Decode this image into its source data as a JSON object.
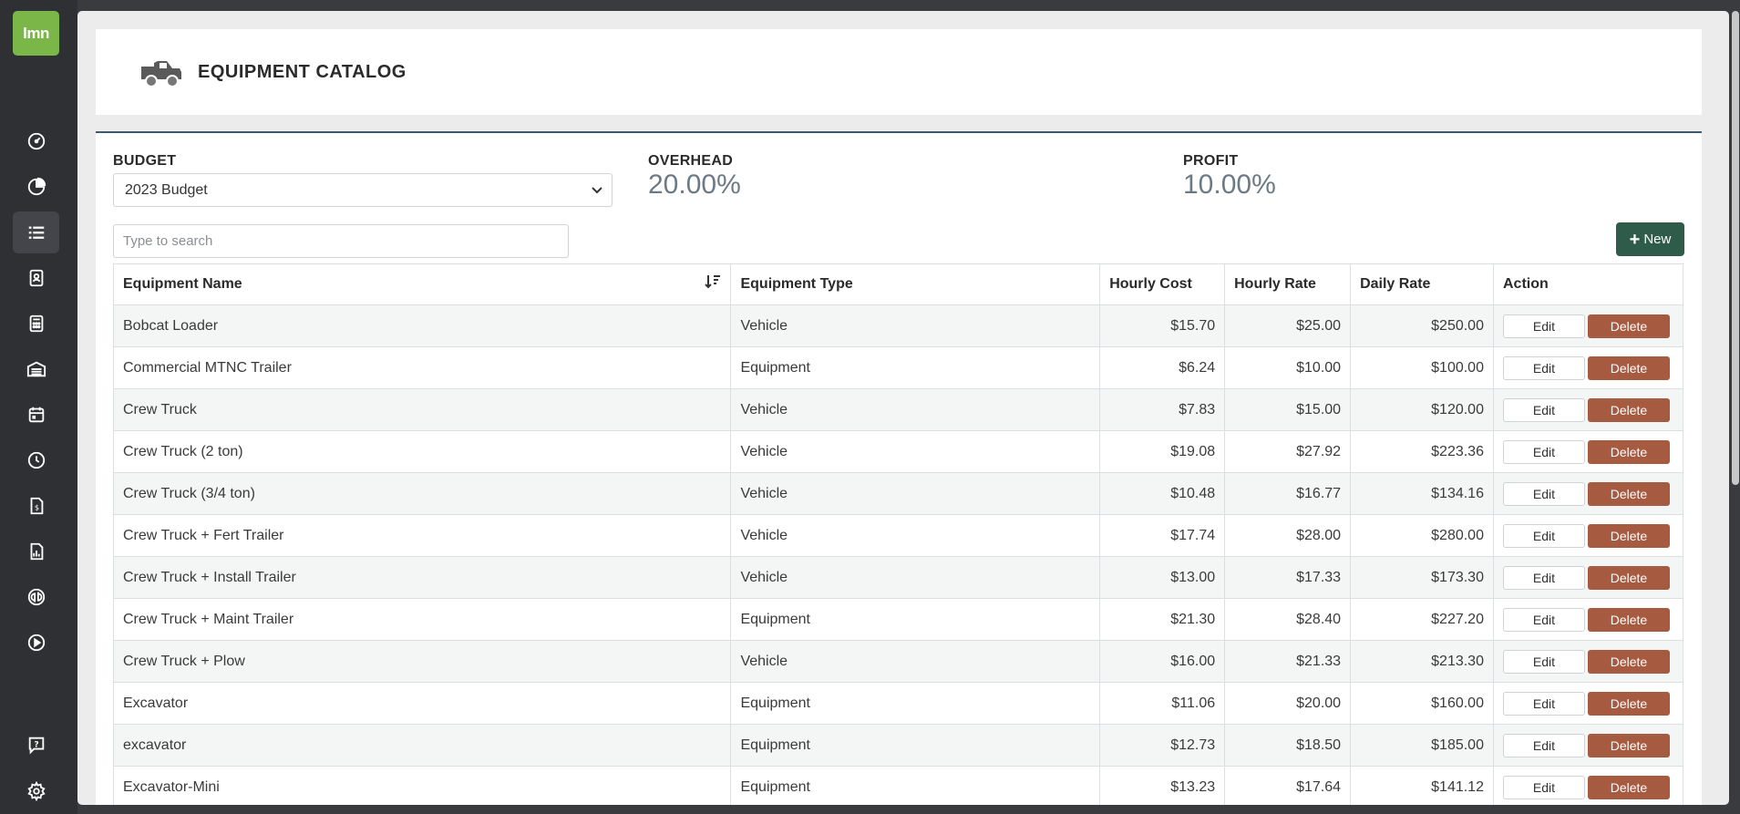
{
  "app": {
    "logo_text": "lmn",
    "accent_color": "#7ab648"
  },
  "sidebar": {
    "items": [
      {
        "icon": "dashboard-icon"
      },
      {
        "icon": "pie-chart-icon"
      },
      {
        "icon": "list-icon",
        "active": true
      },
      {
        "icon": "contact-card-icon"
      },
      {
        "icon": "calculator-icon"
      },
      {
        "icon": "warehouse-icon"
      },
      {
        "icon": "calendar-icon"
      },
      {
        "icon": "clock-icon"
      },
      {
        "icon": "invoice-icon"
      },
      {
        "icon": "report-icon"
      },
      {
        "icon": "quickbooks-icon"
      },
      {
        "icon": "play-icon"
      },
      {
        "icon": "help-icon"
      },
      {
        "icon": "settings-icon"
      }
    ]
  },
  "header": {
    "title": "EQUIPMENT CATALOG",
    "icon": "truck-icon"
  },
  "summary": {
    "budget_label": "BUDGET",
    "budget_value": "2023 Budget",
    "overhead_label": "OVERHEAD",
    "overhead_value": "20.00%",
    "profit_label": "PROFIT",
    "profit_value": "10.00%"
  },
  "search": {
    "placeholder": "Type to search"
  },
  "new_button": {
    "label": "New",
    "color": "#2f5b4a"
  },
  "table": {
    "columns": [
      "Equipment Name",
      "Equipment Type",
      "Hourly Cost",
      "Hourly Rate",
      "Daily Rate",
      "Action"
    ],
    "edit_label": "Edit",
    "delete_label": "Delete",
    "delete_color": "#a65a40",
    "rows": [
      {
        "name": "Bobcat Loader",
        "type": "Vehicle",
        "hourly_cost": "$15.70",
        "hourly_rate": "$25.00",
        "daily_rate": "$250.00"
      },
      {
        "name": "Commercial MTNC Trailer",
        "type": "Equipment",
        "hourly_cost": "$6.24",
        "hourly_rate": "$10.00",
        "daily_rate": "$100.00"
      },
      {
        "name": "Crew Truck",
        "type": "Vehicle",
        "hourly_cost": "$7.83",
        "hourly_rate": "$15.00",
        "daily_rate": "$120.00"
      },
      {
        "name": "Crew Truck (2 ton)",
        "type": "Vehicle",
        "hourly_cost": "$19.08",
        "hourly_rate": "$27.92",
        "daily_rate": "$223.36"
      },
      {
        "name": "Crew Truck (3/4 ton)",
        "type": "Vehicle",
        "hourly_cost": "$10.48",
        "hourly_rate": "$16.77",
        "daily_rate": "$134.16"
      },
      {
        "name": "Crew Truck + Fert Trailer",
        "type": "Vehicle",
        "hourly_cost": "$17.74",
        "hourly_rate": "$28.00",
        "daily_rate": "$280.00"
      },
      {
        "name": "Crew Truck + Install Trailer",
        "type": "Vehicle",
        "hourly_cost": "$13.00",
        "hourly_rate": "$17.33",
        "daily_rate": "$173.30"
      },
      {
        "name": "Crew Truck + Maint Trailer",
        "type": "Equipment",
        "hourly_cost": "$21.30",
        "hourly_rate": "$28.40",
        "daily_rate": "$227.20"
      },
      {
        "name": "Crew Truck + Plow",
        "type": "Vehicle",
        "hourly_cost": "$16.00",
        "hourly_rate": "$21.33",
        "daily_rate": "$213.30"
      },
      {
        "name": "Excavator",
        "type": "Equipment",
        "hourly_cost": "$11.06",
        "hourly_rate": "$20.00",
        "daily_rate": "$160.00"
      },
      {
        "name": "excavator",
        "type": "Equipment",
        "hourly_cost": "$12.73",
        "hourly_rate": "$18.50",
        "daily_rate": "$185.00"
      },
      {
        "name": "Excavator-Mini",
        "type": "Equipment",
        "hourly_cost": "$13.23",
        "hourly_rate": "$17.64",
        "daily_rate": "$141.12"
      }
    ]
  }
}
